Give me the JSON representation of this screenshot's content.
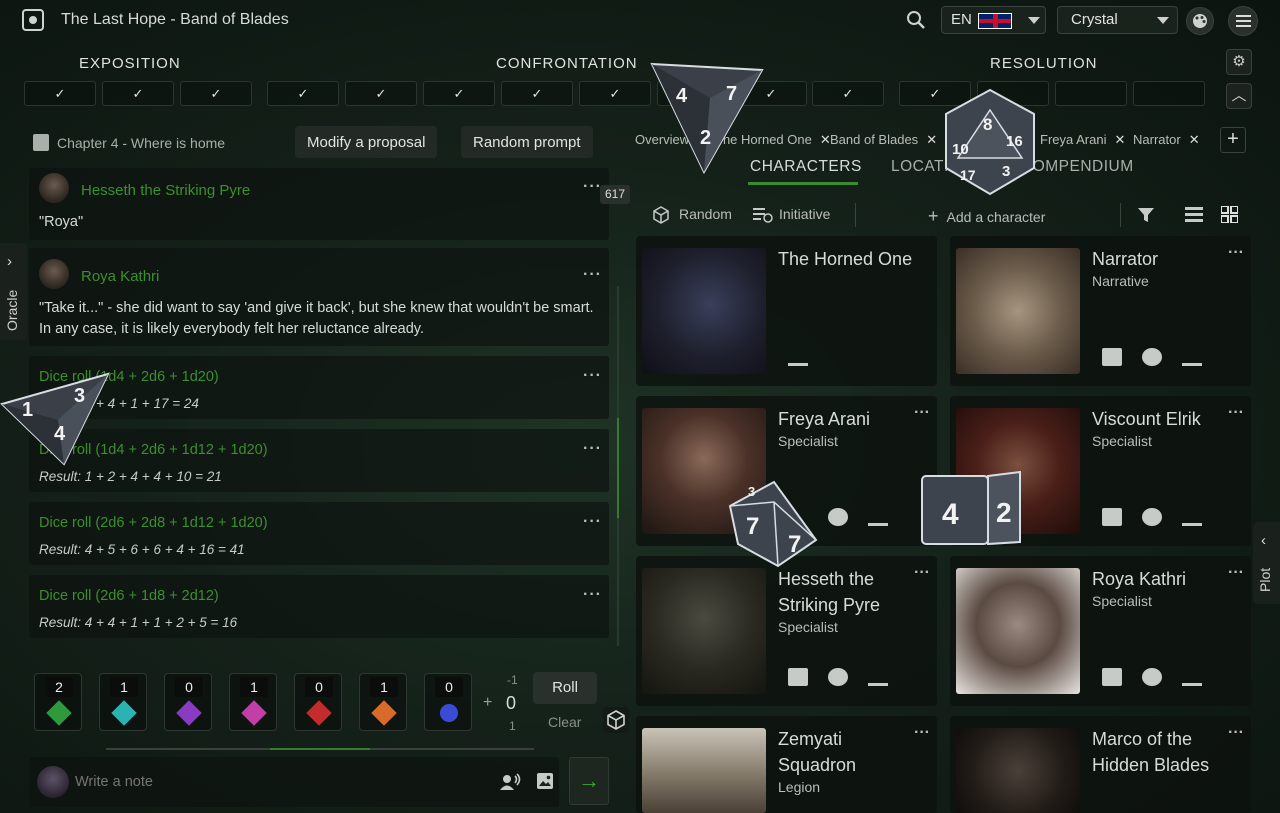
{
  "header": {
    "title": "The Last Hope - Band of Blades",
    "language": "EN",
    "user": "Crystal"
  },
  "plot": {
    "phases": [
      "EXPOSITION",
      "CONFRONTATION",
      "RESOLUTION"
    ],
    "check_mark": "✓"
  },
  "chapter": {
    "title": "Chapter 4 - Where is home",
    "modify_label": "Modify a proposal",
    "random_prompt_label": "Random prompt"
  },
  "feed": {
    "count": "617",
    "messages": [
      {
        "author": "Hesseth the Striking Pyre",
        "text": "\"Roya\""
      },
      {
        "author": "Roya Kathri",
        "text": "\"Take it...\" - she did want to say 'and give it back', but she knew that wouldn't be smart. In any case, it is likely everybody felt her reluctance already."
      }
    ],
    "rolls": [
      {
        "title": "Dice roll (1d4 + 2d6 + 1d20)",
        "result": "Result: 2 + 4 + 1 + 17 = 24"
      },
      {
        "title": "Dice roll (1d4 + 2d6 + 1d12 + 1d20)",
        "result": "Result: 1 + 2 + 4 + 4 + 10 = 21"
      },
      {
        "title": "Dice roll (2d6 + 2d8 + 1d12 + 1d20)",
        "result": "Result: 4 + 5 + 6 + 6 + 4 + 16 = 41"
      },
      {
        "title": "Dice roll (2d6 + 1d8 + 2d12)",
        "result": "Result: 4 + 4 + 1 + 1 + 2 + 5 = 16"
      }
    ]
  },
  "dice_tray": {
    "counts": [
      "2",
      "1",
      "0",
      "1",
      "0",
      "1",
      "0"
    ],
    "colors": [
      "#2e9a3b",
      "#2bb3b3",
      "#8a3bc4",
      "#c23fa7",
      "#c42b2b",
      "#d96b2a",
      "#3b4bd6"
    ],
    "modifier_minus": "-1",
    "modifier_value": "0",
    "modifier_plus": "1",
    "plus_sign": "+",
    "roll_label": "Roll",
    "clear_label": "Clear"
  },
  "note": {
    "placeholder": "Write a note"
  },
  "open_tabs": [
    {
      "label": "Overview"
    },
    {
      "label": "The Horned One"
    },
    {
      "label": "Band of Blades"
    },
    {
      "label": "Freya Arani"
    },
    {
      "label": "Narrator"
    }
  ],
  "main_tabs": [
    "CHARACTERS",
    "LOCATIONS",
    "COMPENDIUM"
  ],
  "toolbar": {
    "random_label": "Random",
    "initiative_label": "Initiative",
    "add_label": "Add a character"
  },
  "characters": [
    {
      "name": "The Horned One",
      "role": ""
    },
    {
      "name": "Narrator",
      "role": "Narrative"
    },
    {
      "name": "Freya Arani",
      "role": "Specialist"
    },
    {
      "name": "Viscount Elrik",
      "role": "Specialist"
    },
    {
      "name": "Hesseth the Striking Pyre",
      "role": "Specialist"
    },
    {
      "name": "Roya Kathri",
      "role": "Specialist"
    },
    {
      "name": "Zemyati Squadron",
      "role": "Legion"
    },
    {
      "name": "Marco of the Hidden Blades",
      "role": ""
    }
  ],
  "side": {
    "oracle_label": "Oracle",
    "plot_label": "Plot"
  },
  "dice_overlay": {
    "d4_a": [
      "4",
      "7",
      "2"
    ],
    "d20_a": [
      "8",
      "16",
      "10",
      "17",
      "3"
    ],
    "d4_b": [
      "3",
      "1",
      "4"
    ],
    "d8": [
      "3",
      "7",
      "7"
    ],
    "d6_a": "4",
    "d6_b": "2"
  }
}
